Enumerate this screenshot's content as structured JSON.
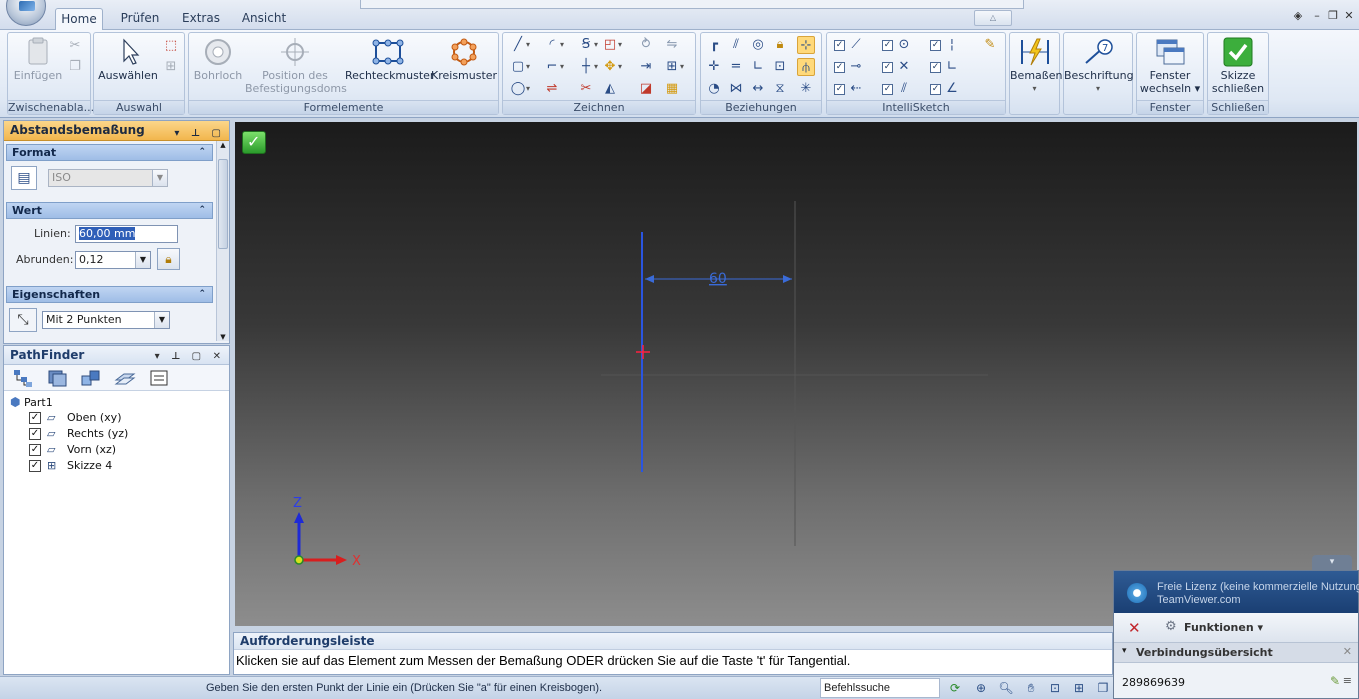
{
  "tabs": [
    "Home",
    "Prüfen",
    "Extras",
    "Ansicht"
  ],
  "ribbon": {
    "groups": {
      "zwischenablage": "Zwischenabla...",
      "auswahl": "Auswahl",
      "formelemente": "Formelemente",
      "zeichnen": "Zeichnen",
      "beziehungen": "Beziehungen",
      "intellisketch": "IntelliSketch",
      "fenster": "Fenster",
      "schliessen": "Schließen"
    },
    "buttons": {
      "einfuegen": "Einfügen",
      "auswaehlen": "Auswählen",
      "bohrloch": "Bohrloch",
      "position_line1": "Position des",
      "position_line2": "Befestigungsdoms",
      "rechteckmuster": "Rechteckmuster",
      "kreismuster": "Kreismuster",
      "bemassen": "Bemaßen",
      "beschriftung": "Beschriftung",
      "fenster_line1": "Fenster",
      "fenster_line2": "wechseln",
      "skizze_line1": "Skizze",
      "skizze_line2": "schließen"
    }
  },
  "command_bar": {
    "title": "Abstandsbemaßung",
    "format": {
      "header": "Format",
      "standard": "ISO"
    },
    "wert": {
      "header": "Wert",
      "linien_label": "Linien:",
      "linien_value": "60,00 mm",
      "abrunden_label": "Abrunden:",
      "abrunden_value": "0,12"
    },
    "eigenschaften": {
      "header": "Eigenschaften",
      "mode": "Mit 2 Punkten"
    }
  },
  "pathfinder": {
    "title": "PathFinder",
    "root": "Part1",
    "items": [
      {
        "label": "Oben (xy)",
        "checked": true
      },
      {
        "label": "Rechts (yz)",
        "checked": true
      },
      {
        "label": "Vorn (xz)",
        "checked": true
      },
      {
        "label": "Skizze 4",
        "checked": true
      }
    ]
  },
  "viewport": {
    "dimension_value": "60",
    "axis_z": "Z",
    "axis_x": "X",
    "colors": {
      "sketch_line": "#2a55e0",
      "dimension": "#3a6bd8",
      "grid_line": "#555555",
      "cursor": "#ff2040",
      "axis_z": "#1e2ad6",
      "axis_x": "#d81e1e"
    }
  },
  "prompt_bar": {
    "title": "Aufforderungsleiste",
    "text": "Klicken sie auf das Element zum Messen der Bemaßung ODER drücken Sie auf die Taste 't' für Tangential."
  },
  "teamviewer": {
    "license_line1": "Freie Lizenz (keine kommerzielle Nutzung)",
    "license_line2": "TeamViewer.com",
    "functions": "Funktionen",
    "connections": "Verbindungsübersicht",
    "session_id": "289869639"
  },
  "statusbar": {
    "text": "Geben Sie den ersten Punkt der Linie ein (Drücken Sie \"a\" für einen Kreisbogen).",
    "search_placeholder": "Befehlssuche"
  }
}
